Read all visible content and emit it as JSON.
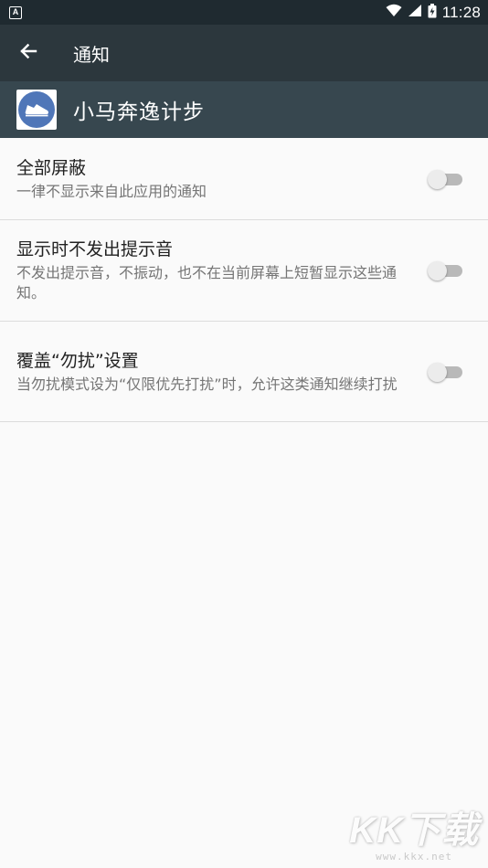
{
  "status_bar": {
    "time": "11:28",
    "notification_icon_label": "A",
    "icons": [
      "wifi-icon",
      "signal-icon",
      "battery-icon"
    ]
  },
  "toolbar": {
    "title": "通知",
    "back_icon": "arrow-back-icon"
  },
  "app": {
    "name": "小马奔逸计步",
    "icon": "shoe-icon"
  },
  "settings": [
    {
      "title": "全部屏蔽",
      "summary": "一律不显示来自此应用的通知",
      "enabled": false
    },
    {
      "title": "显示时不发出提示音",
      "summary": "不发出提示音，不振动，也不在当前屏幕上短暂显示这些通知。",
      "enabled": false
    },
    {
      "title": "覆盖“勿扰”设置",
      "summary": "当勿扰模式设为“仅限优先打扰”时，允许这类通知继续打扰",
      "enabled": false
    }
  ],
  "watermark": {
    "main": "KK下载",
    "sub": "www.kkx.net"
  },
  "colors": {
    "status_bar": "#1f2a30",
    "toolbar": "#2c373d",
    "app_header": "#37474f",
    "background": "#fafafa",
    "app_icon_circle": "#4f76b8"
  }
}
